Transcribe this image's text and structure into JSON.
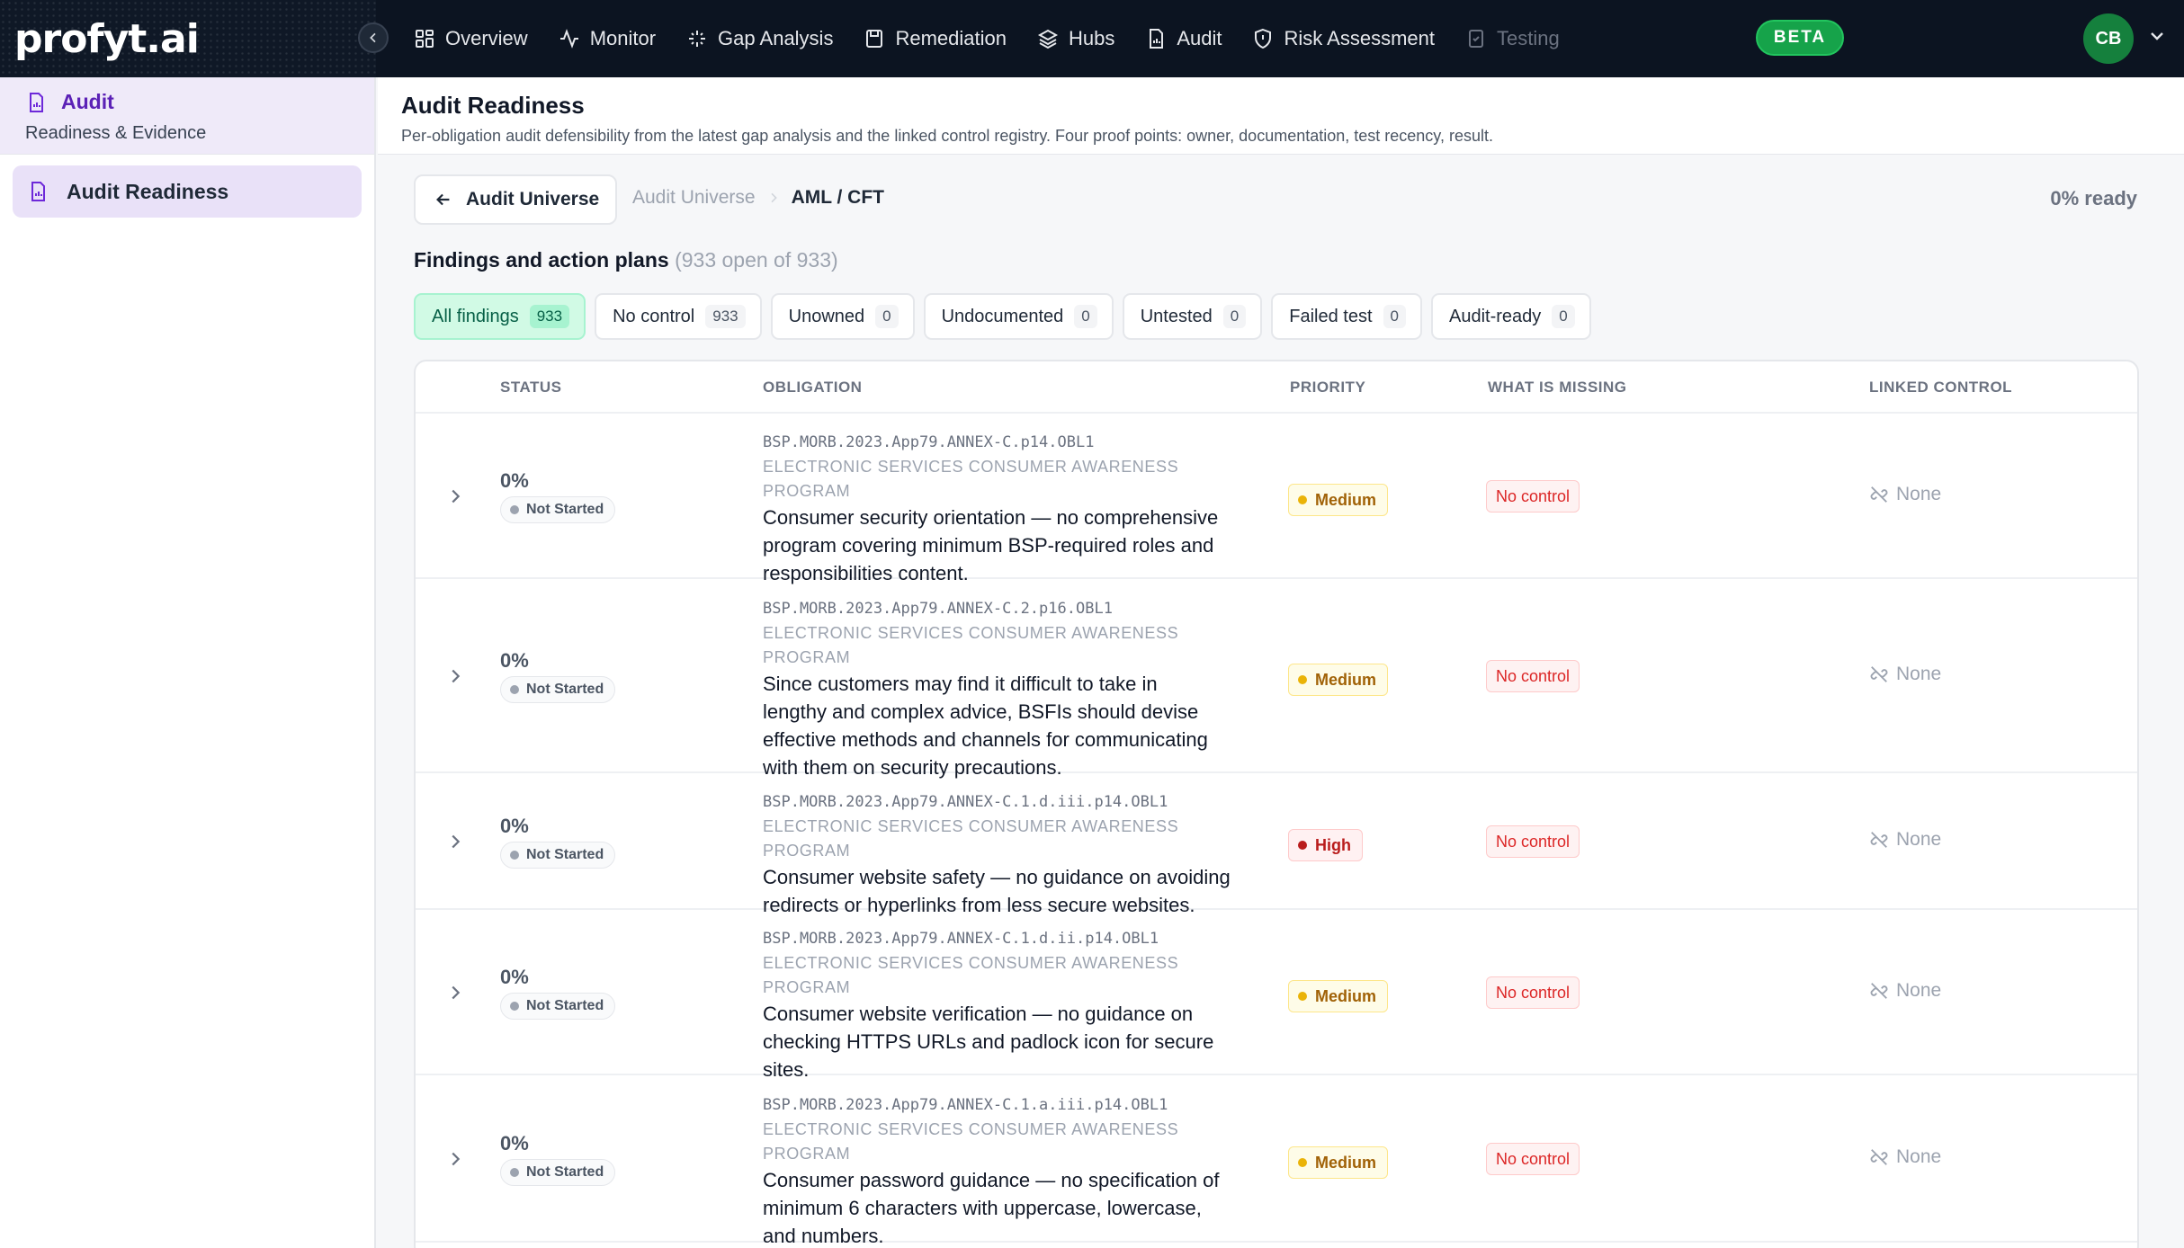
{
  "brand": {
    "logo_text": "profyt.ai"
  },
  "nav": {
    "items": [
      {
        "label": "Overview",
        "icon": "grid-icon"
      },
      {
        "label": "Monitor",
        "icon": "activity-icon"
      },
      {
        "label": "Gap Analysis",
        "icon": "sparkle-icon"
      },
      {
        "label": "Remediation",
        "icon": "clipboard-icon"
      },
      {
        "label": "Hubs",
        "icon": "layers-icon"
      },
      {
        "label": "Audit",
        "icon": "file-chart-icon"
      },
      {
        "label": "Risk Assessment",
        "icon": "shield-icon"
      },
      {
        "label": "Testing",
        "icon": "clipboard-check-icon"
      }
    ],
    "beta_label": "BETA",
    "avatar_initials": "CB"
  },
  "sidebar": {
    "section_title": "Audit",
    "section_subtitle": "Readiness & Evidence",
    "items": [
      {
        "label": "Audit Readiness"
      }
    ]
  },
  "page": {
    "title": "Audit Readiness",
    "subtitle": "Per-obligation audit defensibility from the latest gap analysis and the linked control registry. Four proof points: owner, documentation, test recency, result."
  },
  "breadcrumb": {
    "back_label": "Audit Universe",
    "root": "Audit Universe",
    "current": "AML / CFT",
    "ready_label": "0% ready"
  },
  "findings": {
    "title": "Findings and action plans",
    "summary": "(933 open of 933)"
  },
  "filters": [
    {
      "label": "All findings",
      "count": "933"
    },
    {
      "label": "No control",
      "count": "933"
    },
    {
      "label": "Unowned",
      "count": "0"
    },
    {
      "label": "Undocumented",
      "count": "0"
    },
    {
      "label": "Untested",
      "count": "0"
    },
    {
      "label": "Failed test",
      "count": "0"
    },
    {
      "label": "Audit-ready",
      "count": "0"
    }
  ],
  "table": {
    "columns": [
      "STATUS",
      "OBLIGATION",
      "PRIORITY",
      "WHAT IS MISSING",
      "LINKED CONTROL"
    ],
    "rows": [
      {
        "pct": "0%",
        "status": "Not Started",
        "code": "BSP.MORB.2023.App79.ANNEX-C.p14.OBL1",
        "program": "ELECTRONIC SERVICES CONSUMER AWARENESS PROGRAM",
        "desc": [
          "Consumer security orientation — no comprehensive",
          "program covering minimum BSP-required roles and",
          "responsibilities content."
        ],
        "priority": "Medium",
        "missing": "No control",
        "control": "None"
      },
      {
        "pct": "0%",
        "status": "Not Started",
        "code": "BSP.MORB.2023.App79.ANNEX-C.2.p16.OBL1",
        "program": "ELECTRONIC SERVICES CONSUMER AWARENESS PROGRAM",
        "desc": [
          "Since customers may find it difficult to take in",
          "lengthy and complex advice, BSFIs should devise",
          "effective methods and channels for communicating",
          "with them on security precautions."
        ],
        "priority": "Medium",
        "missing": "No control",
        "control": "None"
      },
      {
        "pct": "0%",
        "status": "Not Started",
        "code": "BSP.MORB.2023.App79.ANNEX-C.1.d.iii.p14.OBL1",
        "program": "ELECTRONIC SERVICES CONSUMER AWARENESS PROGRAM",
        "desc": [
          "Consumer website safety — no guidance on avoiding",
          "redirects or hyperlinks from less secure websites."
        ],
        "priority": "High",
        "missing": "No control",
        "control": "None"
      },
      {
        "pct": "0%",
        "status": "Not Started",
        "code": "BSP.MORB.2023.App79.ANNEX-C.1.d.ii.p14.OBL1",
        "program": "ELECTRONIC SERVICES CONSUMER AWARENESS PROGRAM",
        "desc": [
          "Consumer website verification — no guidance on",
          "checking HTTPS URLs and padlock icon for secure",
          "sites."
        ],
        "priority": "Medium",
        "missing": "No control",
        "control": "None"
      },
      {
        "pct": "0%",
        "status": "Not Started",
        "code": "BSP.MORB.2023.App79.ANNEX-C.1.a.iii.p14.OBL1",
        "program": "ELECTRONIC SERVICES CONSUMER AWARENESS PROGRAM",
        "desc": [
          "Consumer password guidance — no specification of",
          "minimum 6 characters with uppercase, lowercase,",
          "and numbers."
        ],
        "priority": "Medium",
        "missing": "No control",
        "control": "None"
      }
    ]
  }
}
